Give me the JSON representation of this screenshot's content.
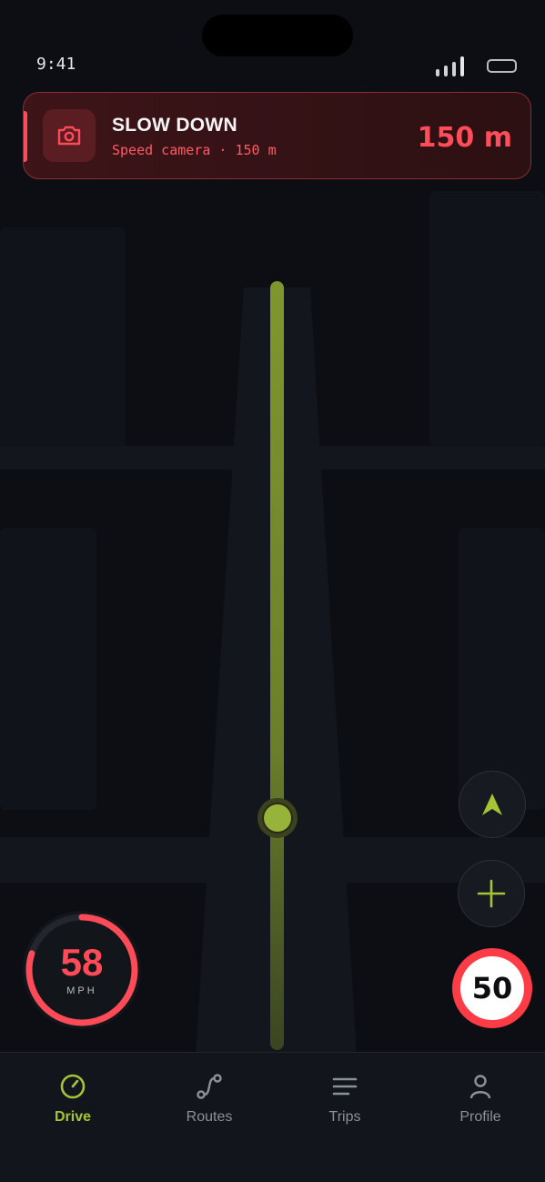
{
  "status_bar": {
    "time": "9:41"
  },
  "alert": {
    "title": "SLOW DOWN",
    "subtitle": "Speed camera · 150 m",
    "distance": "150 m",
    "icon": "camera-icon",
    "color": "#ff4b57"
  },
  "map_controls": {
    "recenter_icon": "navigation-arrow-icon",
    "zoom_in_icon": "plus-icon",
    "accent": "#a6c535"
  },
  "speedometer": {
    "speed": "58",
    "unit": "MPH",
    "level": 0.8
  },
  "speed_limit": {
    "value": "50"
  },
  "tabs": [
    {
      "label": "Drive",
      "icon": "speedometer-icon",
      "active": true
    },
    {
      "label": "Routes",
      "icon": "route-icon",
      "active": false
    },
    {
      "label": "Trips",
      "icon": "list-icon",
      "active": false
    },
    {
      "label": "Profile",
      "icon": "person-icon",
      "active": false
    }
  ]
}
